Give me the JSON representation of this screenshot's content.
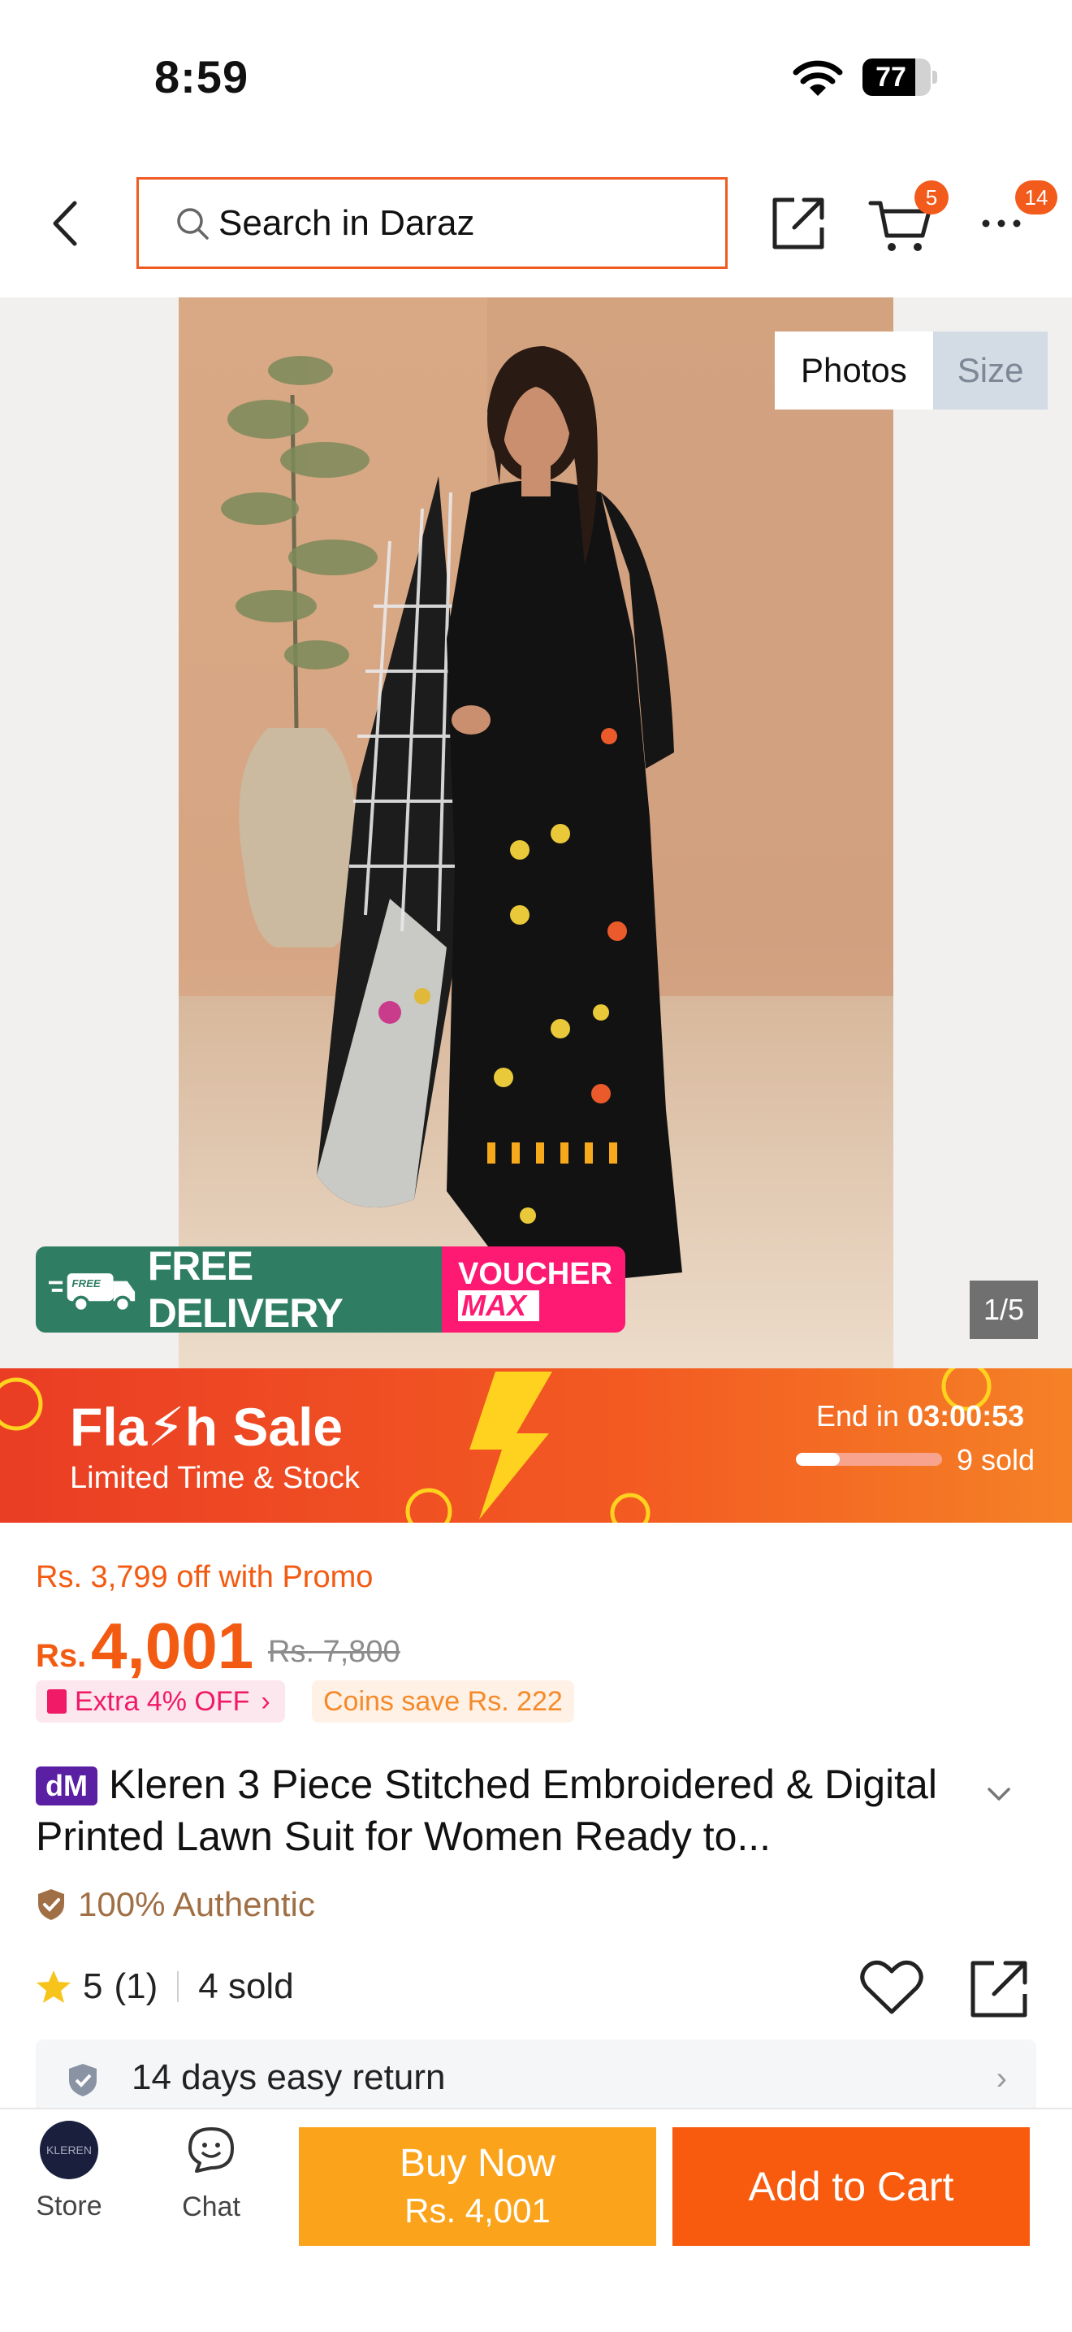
{
  "status_bar": {
    "time": "8:59",
    "battery": "77",
    "battery_level": 0.77
  },
  "nav": {
    "search_placeholder": "Search in Daraz",
    "cart_count": "5",
    "more_count": "14"
  },
  "gallery": {
    "tabs": [
      "Photos",
      "Size"
    ],
    "counter": "1/5",
    "delivery_badge": "FREE DELIVERY",
    "voucher_line1": "VOUCHER",
    "voucher_line2": "MAX",
    "truck_label": "FREE"
  },
  "flash_sale": {
    "title": "Fla⚡h Sale",
    "subtitle": "Limited Time & Stock",
    "end_label": "End in",
    "countdown": "03:00:53",
    "sold": "9 sold",
    "sold_progress": 0.3
  },
  "price": {
    "promo_text": "Rs. 3,799 off with Promo",
    "currency": "Rs.",
    "current": "4,001",
    "original": "Rs. 7,800",
    "extra_off": "Extra 4% OFF",
    "coins": "Coins save Rs. 222"
  },
  "product": {
    "brand_badge": "dM",
    "title": "Kleren 3 Piece Stitched Embroidered & Digital Printed Lawn Suit for Women Ready to...",
    "authentic": "100% Authentic",
    "rating": "5",
    "rating_count": "(1)",
    "sold": "4 sold"
  },
  "service": {
    "return_text": "14 days easy return"
  },
  "bottom_bar": {
    "store_label": "Store",
    "store_avatar": "KLEREN",
    "chat_label": "Chat",
    "buy_now": "Buy Now",
    "buy_now_price": "Rs. 4,001",
    "add_to_cart": "Add to Cart"
  },
  "colors": {
    "brand_orange": "#f35b22",
    "buy_now": "#fba41b",
    "add_to_cart": "#f85b0d",
    "free_delivery_green": "#2f7e63",
    "voucher_pink": "#fe1a72"
  }
}
